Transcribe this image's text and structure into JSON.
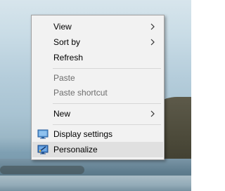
{
  "context_menu": {
    "items": [
      {
        "label": "View",
        "submenu": true,
        "enabled": true
      },
      {
        "label": "Sort by",
        "submenu": true,
        "enabled": true
      },
      {
        "label": "Refresh",
        "submenu": false,
        "enabled": true
      },
      {
        "label": "Paste",
        "submenu": false,
        "enabled": false
      },
      {
        "label": "Paste shortcut",
        "submenu": false,
        "enabled": false
      },
      {
        "label": "New",
        "submenu": true,
        "enabled": true
      },
      {
        "label": "Display settings",
        "submenu": false,
        "enabled": true,
        "icon": "display-icon"
      },
      {
        "label": "Personalize",
        "submenu": false,
        "enabled": true,
        "icon": "personalize-icon",
        "highlighted": true
      }
    ]
  },
  "colors": {
    "menu_background": "#f2f2f2",
    "menu_border": "#a0a0a0",
    "highlight": "#e0e0e0",
    "disabled_text": "#6d6d6d"
  }
}
